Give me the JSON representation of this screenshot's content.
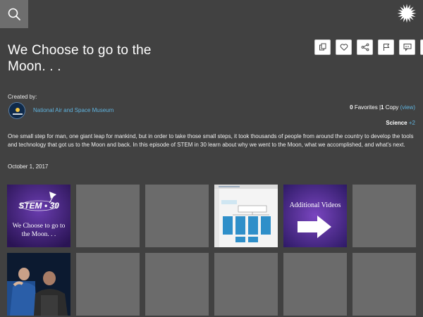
{
  "header": {
    "search_icon": "search-icon",
    "logo_icon": "sunburst-logo-icon"
  },
  "actions": [
    {
      "name": "copy-button",
      "icon": "copy-icon"
    },
    {
      "name": "favorite-button",
      "icon": "heart-icon"
    },
    {
      "name": "share-button",
      "icon": "share-icon"
    },
    {
      "name": "flag-button",
      "icon": "flag-icon"
    },
    {
      "name": "comment-button",
      "icon": "speech-bubble-icon"
    },
    {
      "name": "info-button",
      "icon": "info-icon"
    }
  ],
  "page": {
    "title": "We Choose to go to the Moon. . .",
    "created_by_label": "Created by:",
    "creator": "National Air and Space Museum",
    "favorites_count": "0",
    "favorites_label": "Favorites",
    "stats_separator": "|",
    "copy_count": "1",
    "copy_label": "Copy",
    "view_link": "(view)",
    "subject": "Science",
    "subject_more": "+2",
    "description": "One small step for man, one giant leap for mankind, but in order to take those small steps, it took thousands of people from around the country to develop the tools and technology that got us to the Moon and back. In this episode of STEM in 30 learn about why we went to the Moon, what we accomplished, and what's next.",
    "date": "October 1, 2017"
  },
  "tiles": {
    "stem_logo_text": "STEM",
    "stem_logo_number": "30",
    "stem_caption": "We Choose to go to the Moon. . .",
    "additional_videos": "Additional Videos"
  },
  "colors": {
    "background": "#414141",
    "tile_placeholder": "#6b6b6b",
    "link": "#5fb3de"
  }
}
